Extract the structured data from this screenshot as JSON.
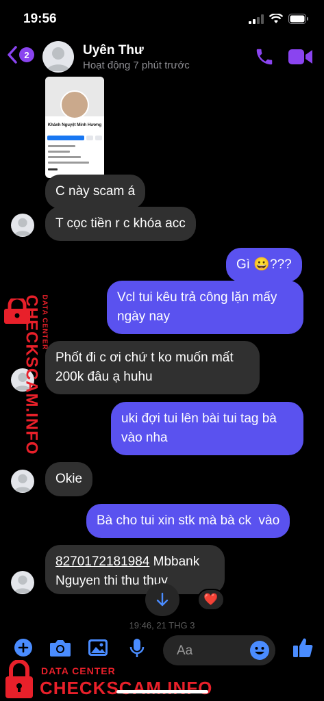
{
  "status_bar": {
    "time": "19:56"
  },
  "header": {
    "back_badge": "2",
    "contact_name": "Uyên Thư",
    "contact_status": "Hoạt động 7 phút trước"
  },
  "shared_image": {
    "profile_name": "Khánh Nguyệt Minh Hương"
  },
  "messages": [
    {
      "side": "in",
      "text": "C này scam á"
    },
    {
      "side": "in",
      "text": "T cọc tiền r c khóa acc"
    },
    {
      "side": "out",
      "text_before": "Gì ",
      "emoji": "😀",
      "text_after": "???"
    },
    {
      "side": "out",
      "lines": [
        "Vcl tui kêu trả công lặn mấy",
        "ngày nay"
      ]
    },
    {
      "side": "in",
      "lines": [
        "Phốt đi c ơi chứ t ko muốn mất",
        "200k đâu ạ huhu"
      ]
    },
    {
      "side": "out",
      "lines": [
        "uki đợi tui lên bài tui tag bà",
        "vào nha"
      ]
    },
    {
      "side": "in",
      "text": "Okie"
    },
    {
      "side": "out",
      "text": "Bà cho tui xin stk mà bà ck  vào"
    },
    {
      "side": "in",
      "account_number": "8270172181984",
      "bank": " Mbbank",
      "line2": "Nguyen thi thu thuy"
    }
  ],
  "reaction": "❤️",
  "timestamp": "19:46, 21 THG 3",
  "composer": {
    "placeholder": "Aa"
  },
  "watermark": {
    "small": "DATA CENTER",
    "big": "CHECKSCAM.INFO"
  },
  "colors": {
    "accent": "#8a44f0",
    "outgoing_bubble": "#5a52ef",
    "incoming_bubble": "#303030",
    "watermark": "#e8202a"
  }
}
